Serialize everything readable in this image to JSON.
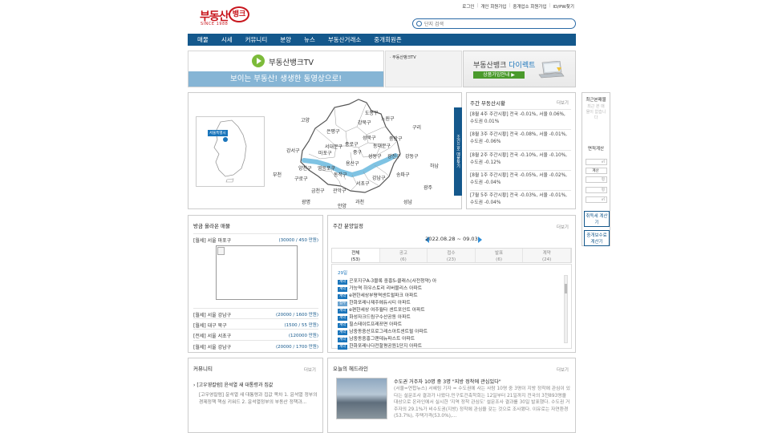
{
  "logo": {
    "text1": "부동산",
    "text2": "뱅크",
    "since": "SINCE 1988"
  },
  "toplinks": [
    "로그인",
    "개인 회원가입",
    "중개업소 회원가입",
    "ID/PW찾기"
  ],
  "search": {
    "placeholder": "단지 검색"
  },
  "nav": [
    "매물",
    "시세",
    "커뮤니티",
    "분양",
    "뉴스",
    "부동산거래소",
    "중개회원존"
  ],
  "tv": {
    "title": "부동산뱅크TV",
    "slogan": "보이는 부동산! 생생한 동영상으로!",
    "list_title": "· 부동산뱅크TV"
  },
  "direct": {
    "title_a": "부동산뱅크 ",
    "title_b": "다이렉트",
    "button": "상품가입안내 ▶"
  },
  "map": {
    "korea_tag": "서울특별시",
    "side_tab": "조건으로 매물찾기",
    "districts": [
      "도봉구",
      "강북구",
      "노원구",
      "고양",
      "은평구",
      "성북구",
      "중랑구",
      "구리",
      "종로구",
      "동대문구",
      "서대문구",
      "마포구",
      "중구",
      "강서구",
      "성동구",
      "광진구",
      "강동구",
      "용산구",
      "양천구",
      "영등포구",
      "동작구",
      "하남",
      "부천",
      "구로구",
      "강남구",
      "송파구",
      "금천구",
      "관악구",
      "서초구",
      "광주",
      "광명",
      "안양",
      "과천",
      "성남"
    ]
  },
  "market": {
    "title": "주간 부동산시황",
    "more": "더보기",
    "items": [
      "[8월 4주 주간시황] 전국 -0.01%, 서울 0.06%, 수도권 0.01%",
      "[8월 3주 주간시황] 전국 -0.08%, 서울 -0.01%, 수도권 -0.06%",
      "[8월 2주 주간시황] 전국 -0.10%, 서울 -0.10%, 수도권 -0.12%",
      "[8월 1주 주간시황] 전국 -0.05%, 서울 -0.02%, 수도권 -0.04%",
      "[7월 5주 주간시황] 전국 -0.03%, 서울 -0.01%, 수도권 -0.04%"
    ]
  },
  "quick": {
    "recent_title": "최근본매물",
    "recent_empty": "최근 본 매물이 없습니다",
    "area_title": "면적계산",
    "inputs": [
      "㎡",
      "계산",
      "평",
      "평",
      "㎡"
    ],
    "loan_btn": "취득세 계산기",
    "fee_btn": "중개보수료 계산기"
  },
  "recent": {
    "title": "방금 올라온 매물",
    "rows": [
      {
        "label": "[월세] 서울 마포구",
        "price": "(30000 / 450 만원)"
      },
      {
        "label": "[월세] 서울 강남구",
        "price": "(20000 / 1600 만원)"
      },
      {
        "label": "[월세] 대구 북구",
        "price": "(1500 / 55 만원)"
      },
      {
        "label": "[전세] 서울 서초구",
        "price": "(120000 만원)"
      },
      {
        "label": "[월세] 서울 강남구",
        "price": "(20000 / 1700 만원)"
      }
    ]
  },
  "schedule": {
    "title": "주간 분양일정",
    "more": "더보기",
    "week": "2022.08.28 ~ 09.03",
    "tabs": [
      {
        "name": "전체",
        "count": "(53)"
      },
      {
        "name": "공고",
        "count": "(6)"
      },
      {
        "name": "접수",
        "count": "(23)"
      },
      {
        "name": "발표",
        "count": "(6)"
      },
      {
        "name": "계약",
        "count": "(24)"
      }
    ],
    "date": "29일",
    "items": [
      {
        "badge": "계약",
        "text": "곤포지구A-3블록 중흥S-클래스(사전청약) 아"
      },
      {
        "badge": "계약",
        "text": "가능역 하우스토리 리버블리스 아파트"
      },
      {
        "badge": "계약",
        "text": "e편한세상부평역센트럴파크 아파트"
      },
      {
        "badge": "접수",
        "text": "한화포레나제주에듀시티 아파트"
      },
      {
        "badge": "계약",
        "text": "e편한세상 여주월타 센트포인트 아파트"
      },
      {
        "badge": "계약",
        "text": "화성자크드림구수산공동 아파트"
      },
      {
        "badge": "계약",
        "text": "힐스테이트프레쯔면 아파트"
      },
      {
        "badge": "계약",
        "text": "남중동중산프로그레스아트센트럴 아파트"
      },
      {
        "badge": "계약",
        "text": "남중동중흥그랜데뉴파스트 아파트"
      },
      {
        "badge": "계약",
        "text": "한화포레나다전할평공원1단지 아파트"
      }
    ]
  },
  "community": {
    "title": "커뮤니티",
    "more": "더보기",
    "headline": "[고우영칼럼] 윤석열 새 대통령과 집값",
    "body": "[고우영칼럼] 윤석열 새 대통령과 집값 목차 1. 윤석열 정부의 경제정책 핵심 키워드    2. 윤석열정부의 부동산 정책과..."
  },
  "news": {
    "title": "오늘의 헤드라인",
    "more": "더보기",
    "headline": "수도권 거주자 10명 중 3명 \"지방 정착에 관심있다\"",
    "body": "(서울=연합뉴스) 서혜림 기자 = 수도권에 사는 사람 10명 중 3명이 지방 정착에 관심이 있다는 설문조사 결과가 나왔다.민구토건축학회는 12일부터 21일까지 전국의 3천893명을 대상으로 온라인에서 실시한 '지역 정착 관심도' 설문조사 결과를 30일 발표했다. 수도권 거주자의 29.1%가 비수도권(지방) 정착에 관심을 갖는 것으로 조사됐다. 이유로는 자연환경(53.7%), 주택가격(53.0%),..."
  }
}
